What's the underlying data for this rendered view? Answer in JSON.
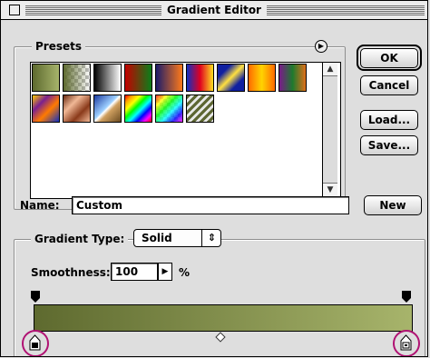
{
  "window": {
    "title": "Gradient Editor"
  },
  "presets": {
    "label": "Presets",
    "menu_icon": "circle-arrow-icon",
    "swatches": [
      {
        "name": "foreground-to-background",
        "fill": "linear-gradient(90deg,#5e6a2f,#a7b46b)"
      },
      {
        "name": "foreground-to-transparent",
        "fill": "linear-gradient(90deg,rgba(94,106,47,1),rgba(94,106,47,0)),repeating-conic-gradient(#bdbdbd 0 25%,#fff 0 50%) 0 0/8px 8px"
      },
      {
        "name": "black-white",
        "fill": "linear-gradient(90deg,#000,#fff)"
      },
      {
        "name": "red-green",
        "fill": "linear-gradient(90deg,#c40000,#0a7f1a)"
      },
      {
        "name": "violet-orange",
        "fill": "linear-gradient(90deg,#1b1b6a,#ff7a1a)"
      },
      {
        "name": "blue-red-yellow",
        "fill": "linear-gradient(90deg,#1030c0,#e00020,#ffe020)"
      },
      {
        "name": "blue-yellow-blue",
        "fill": "linear-gradient(135deg,#1020a0 25%,#ffe040 50%,#1020a0 75%)"
      },
      {
        "name": "orange-yellow-orange",
        "fill": "linear-gradient(90deg,#ff6a00,#ffd400,#ff6a00)"
      },
      {
        "name": "violet-green-orange",
        "fill": "linear-gradient(90deg,#7a1a8a,#1d7a2d,#e0701a)"
      },
      {
        "name": "yellow-violet-orange-blue",
        "fill": "linear-gradient(135deg,#ffcc00 0%,#7a2090 30%,#ff7a00 60%,#1030c0 100%)"
      },
      {
        "name": "copper",
        "fill": "linear-gradient(135deg,#6a2a12,#f0b896,#8a3a1a,#f0b896)"
      },
      {
        "name": "chrome",
        "fill": "linear-gradient(135deg,#1a3aa0 0%,#9ed0ff 45%,#ffffff 50%,#d0a060 60%,#6a4a20 100%)"
      },
      {
        "name": "spectrum",
        "fill": "linear-gradient(135deg,red,orange,yellow,lime,cyan,blue,magenta,red)"
      },
      {
        "name": "transparent-rainbow",
        "fill": "linear-gradient(135deg,rgba(255,0,0,.8),rgba(255,255,0,.8),rgba(0,255,0,.8),rgba(0,255,255,.8),rgba(0,0,255,.8),rgba(255,0,255,.8)),repeating-conic-gradient(#bdbdbd 0 25%,#fff 0 50%) 0 0/8px 8px"
      },
      {
        "name": "transparent-stripes",
        "fill": "repeating-linear-gradient(135deg,#5d6633 0 3px,#e8e8e8 3px 6px)"
      }
    ]
  },
  "buttons": {
    "ok": "OK",
    "cancel": "Cancel",
    "load": "Load...",
    "save": "Save...",
    "new": "New"
  },
  "name_field": {
    "label": "Name:",
    "value": "Custom"
  },
  "gradient_type": {
    "label": "Gradient Type:",
    "value": "Solid"
  },
  "smoothness": {
    "label": "Smoothness:",
    "value": "100",
    "unit": "%"
  },
  "gradient": {
    "start_color": "#5e6a2f",
    "end_color": "#a7b46b"
  },
  "accent": "#b01273"
}
